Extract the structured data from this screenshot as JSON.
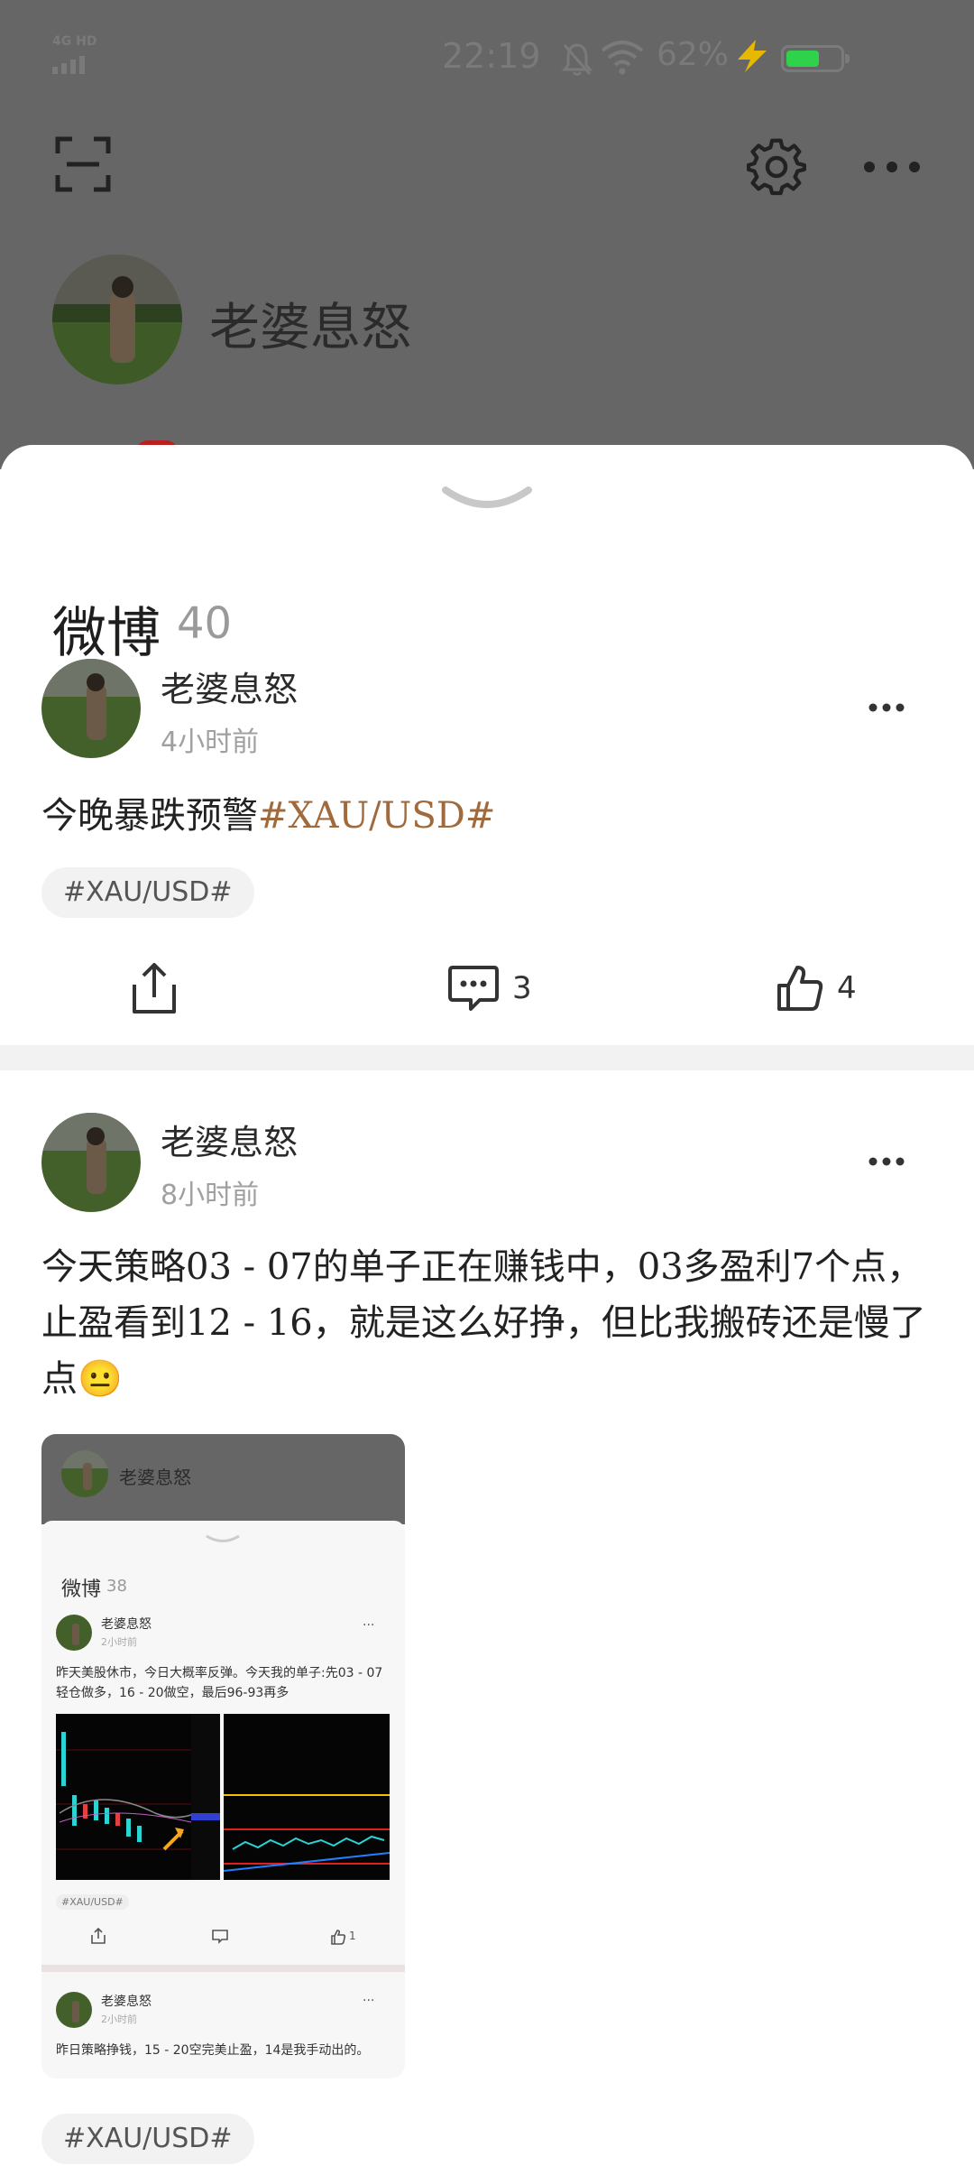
{
  "status_bar": {
    "network": "4G HD",
    "time": "22:19",
    "battery_percent": "62%",
    "battery_level": 0.62,
    "battery_color": "#2fd24b",
    "charging_color": "#e6b800"
  },
  "profile": {
    "name": "老婆息怒"
  },
  "sheet": {
    "title": "微博",
    "count": "40"
  },
  "posts": [
    {
      "author": "老婆息怒",
      "time": "4小时前",
      "text_main": "今晚暴跌预警",
      "text_tag": "#XAU/USD#",
      "tag_chip": "#XAU/USD#",
      "comments": "3",
      "likes": "4"
    },
    {
      "author": "老婆息怒",
      "time": "8小时前",
      "text": "今天策略03 - 07的单子正在赚钱中，03多盈利7个点，止盈看到12 - 16，就是这么好挣，但比我搬砖还是慢了点😐",
      "tag_chip": "#XAU/USD#",
      "image": {
        "header_name": "老婆息怒",
        "title": "微博",
        "count": "38",
        "post1_author": "老婆息怒",
        "post1_time": "2小时前",
        "post1_text": "昨天美股休市，今日大概率反弹。今天我的单子:先03 - 07轻仓做多，16 - 20做空，最后96-93再多",
        "post1_tag": "#XAU/USD#",
        "post1_likes": "1",
        "post2_author": "老婆息怒",
        "post2_time": "2小时前",
        "post2_text": "昨日策略挣钱，15 - 20空完美止盈，14是我手动出的。"
      }
    }
  ],
  "colors": {
    "tag_link": "#a06a3c",
    "dim_overlay": "#666666",
    "chip_bg": "#f2f2f2"
  }
}
